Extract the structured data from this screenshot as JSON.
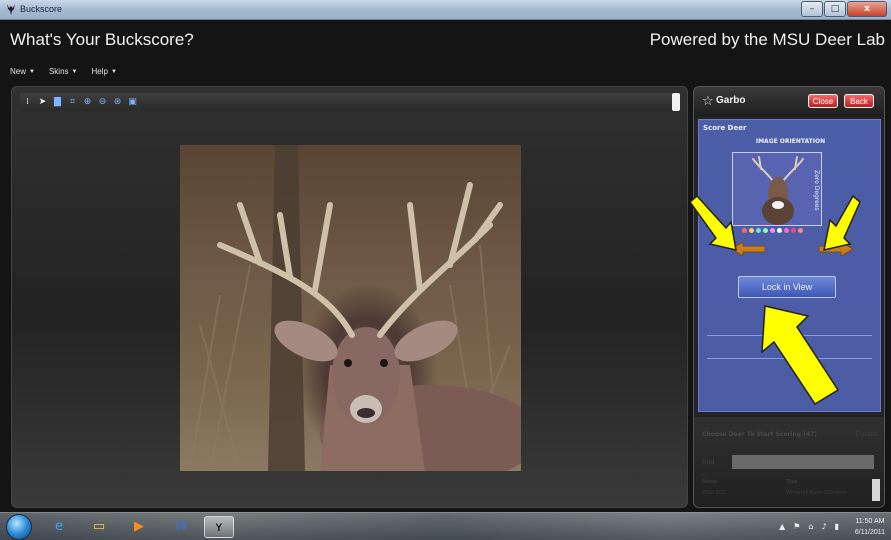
{
  "window": {
    "title": "Buckscore",
    "minimize": "–",
    "maximize": "□",
    "close": "x"
  },
  "header": {
    "title": "What's Your Buckscore?",
    "powered_by": "Powered by the MSU Deer Lab"
  },
  "menu": {
    "items": [
      {
        "label": "New"
      },
      {
        "label": "Skins"
      },
      {
        "label": "Help"
      }
    ]
  },
  "toolbar": {
    "icons": [
      "pointer-icon",
      "save-icon",
      "crop-icon",
      "zoom-in-icon",
      "zoom-out-icon",
      "zoom-fit-icon",
      "screen-icon"
    ]
  },
  "side_panel": {
    "title": "Garbo",
    "close_label": "Close",
    "back_label": "Back",
    "score_label": "Score Deer",
    "orientation_label": "IMAGE ORIENTATION",
    "degree_label": "Zero Degrees",
    "lock_label": "Lock in View",
    "dot_colors": [
      "#ff6666",
      "#ffd84a",
      "#6ae0ff",
      "#8effa6",
      "#ff88ff",
      "#ffffff",
      "#ff66cc",
      "#ff4477",
      "#ff8888"
    ],
    "lower": {
      "title": "Choose Deer To Start Scoring (47)",
      "expand": "Expand",
      "search_label": "Find",
      "col1": "Name",
      "col2": "Type",
      "val1": "WSD 102",
      "val2": "Whitetail Buck 350 docs"
    }
  },
  "taskbar": {
    "time": "11:50 AM",
    "date": "6/11/2011"
  },
  "colors": {
    "accent_red": "#c11b1b",
    "panel_blue": "#4d5ea8",
    "overlay_yellow": "#ffff00"
  }
}
